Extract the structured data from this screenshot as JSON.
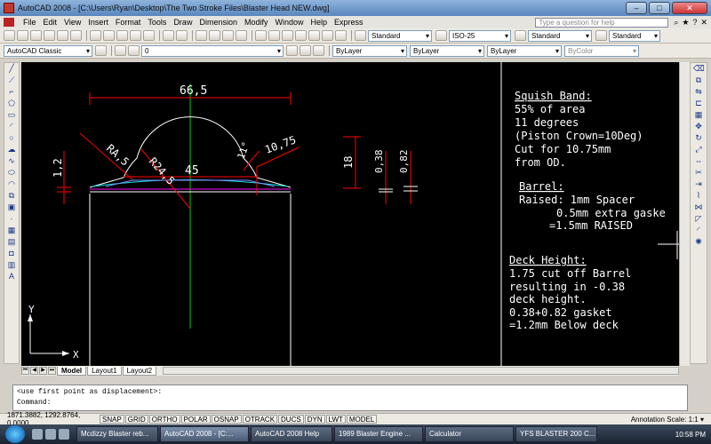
{
  "window": {
    "title": "AutoCAD 2008 - [C:\\Users\\Ryan\\Desktop\\The Two Stroke Files\\Blaster Head NEW.dwg]"
  },
  "menu": {
    "items": [
      "File",
      "Edit",
      "View",
      "Insert",
      "Format",
      "Tools",
      "Draw",
      "Dimension",
      "Modify",
      "Window",
      "Help",
      "Express"
    ],
    "help_placeholder": "Type a question for help"
  },
  "toolbar": {
    "text_style": "Standard",
    "dim_style": "ISO-25",
    "table_style": "Standard",
    "mleader_style": "Standard",
    "workspace": "AutoCAD Classic",
    "layer": "0",
    "color": "ByLayer",
    "linetype": "ByLayer",
    "lineweight": "ByLayer",
    "plotstyle": "ByColor"
  },
  "drawing": {
    "dims": {
      "d665": "66,5",
      "d45": "45",
      "r245": "R24,5",
      "ra5": "RA,5",
      "deg": "11°",
      "d1075": "10,75",
      "d12": "1,2",
      "d18": "18",
      "d038": "0,38",
      "d082": "0,82"
    },
    "axis": {
      "x": "X",
      "y": "Y"
    },
    "notes": {
      "squish_title": "Squish Band:",
      "squish_lines": [
        "55% of area",
        "11 degrees",
        "(Piston Crown=10Deg)",
        "Cut for 10.75mm",
        "from OD."
      ],
      "barrel_title": "Barrel:",
      "barrel_lines": [
        "Raised: 1mm Spacer",
        "0.5mm extra gaske",
        "=1.5mm RAISED"
      ],
      "deck_title": "Deck Height:",
      "deck_lines": [
        "1.75 cut off Barrel",
        "resulting in -0.38",
        "deck height.",
        "0.38+0.82 gasket",
        "=1.2mm Below deck"
      ]
    }
  },
  "tabs": [
    "Model",
    "Layout1",
    "Layout2"
  ],
  "command": {
    "history": "<use first point as displacement>:",
    "prompt": "Command:"
  },
  "status": {
    "coords": "1871.3882, 1292.8764, 0.0000",
    "buttons": [
      "SNAP",
      "GRID",
      "ORTHO",
      "POLAR",
      "OSNAP",
      "OTRACK",
      "DUCS",
      "DYN",
      "LWT",
      "MODEL"
    ],
    "annotation_scale": "Annotation Scale: 1:1 ▾"
  },
  "taskbar": {
    "items": [
      "Mcdizzy Blaster reb...",
      "AutoCAD 2008 - [C:...",
      "AutoCAD 2008 Help",
      "1989 Blaster Engine ...",
      "Calculator",
      "YFS BLASTER 200 C..."
    ],
    "clock": "10:58 PM"
  },
  "colors": {
    "dim": "#ff0000",
    "geometry": "#ffffff",
    "centerline": "#00cc00",
    "cyan": "#00e5e5",
    "magenta": "#ff00ff"
  }
}
